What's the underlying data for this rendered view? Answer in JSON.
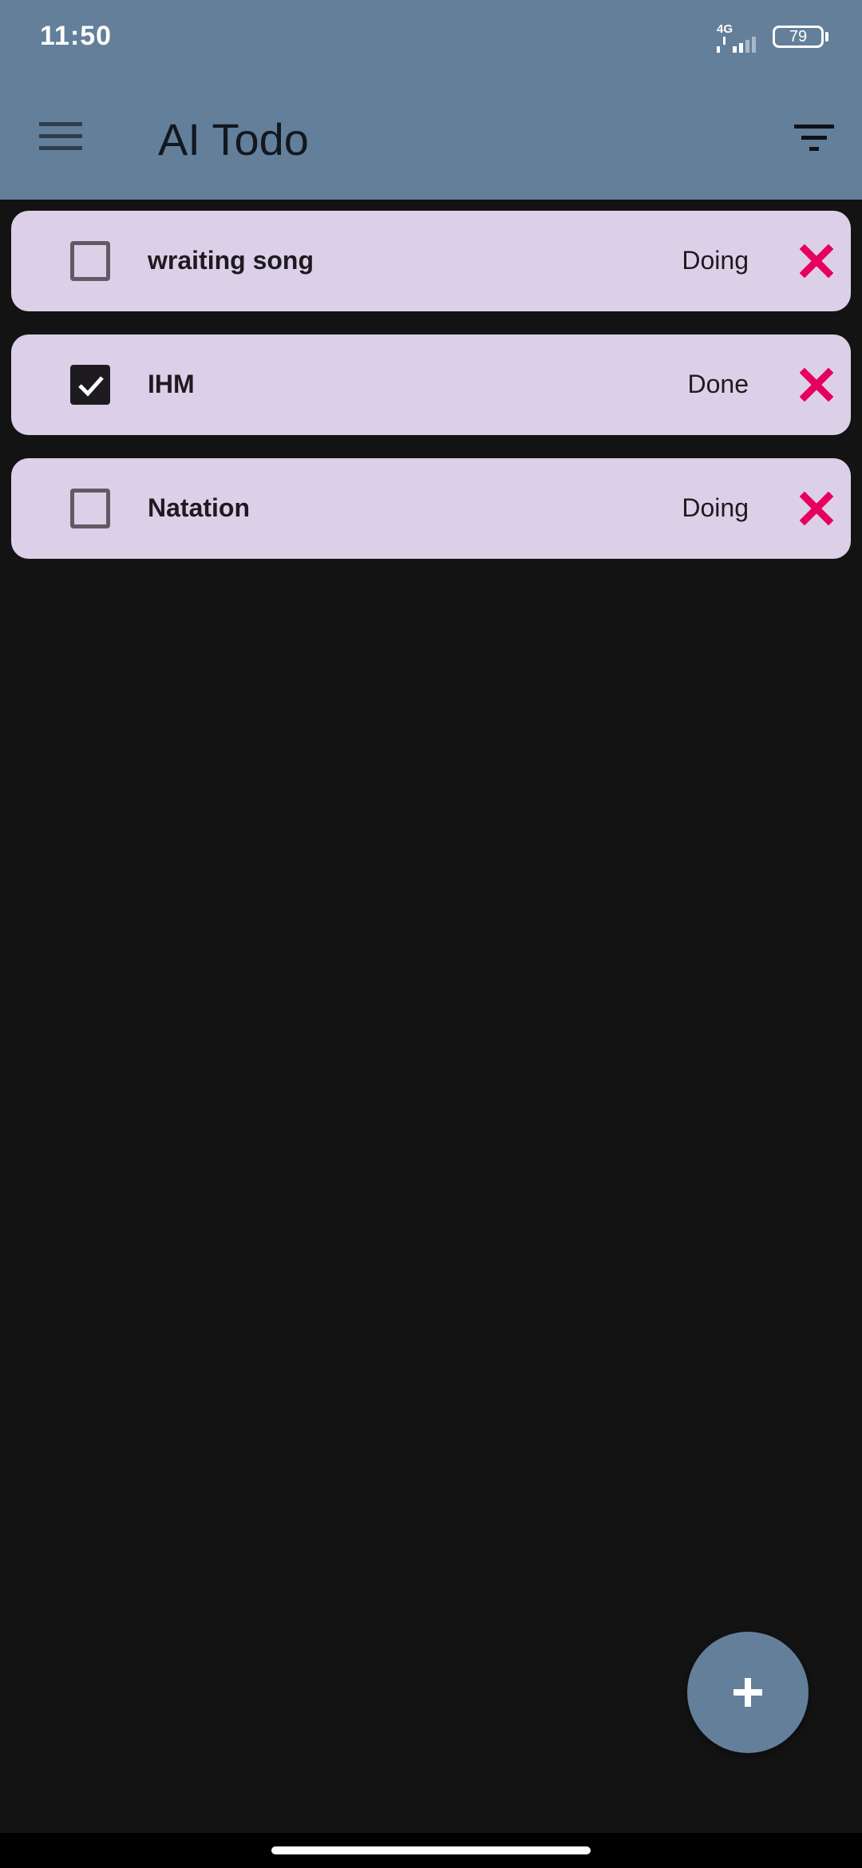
{
  "status_bar": {
    "time": "11:50",
    "network": "4G",
    "battery": "79"
  },
  "app_bar": {
    "title": "AI Todo",
    "background": "#647f9a",
    "icons": {
      "menu": "menu-icon",
      "filter": "filter-icon"
    }
  },
  "todos": [
    {
      "title": "wraiting song",
      "status": "Doing",
      "checked": false
    },
    {
      "title": "IHM",
      "status": "Done",
      "checked": true
    },
    {
      "title": "Natation",
      "status": "Doing",
      "checked": false
    }
  ],
  "colors": {
    "card": "#dcd0e8",
    "delete": "#e6005c",
    "page": "#131313"
  },
  "fab": {
    "icon": "plus-icon"
  }
}
